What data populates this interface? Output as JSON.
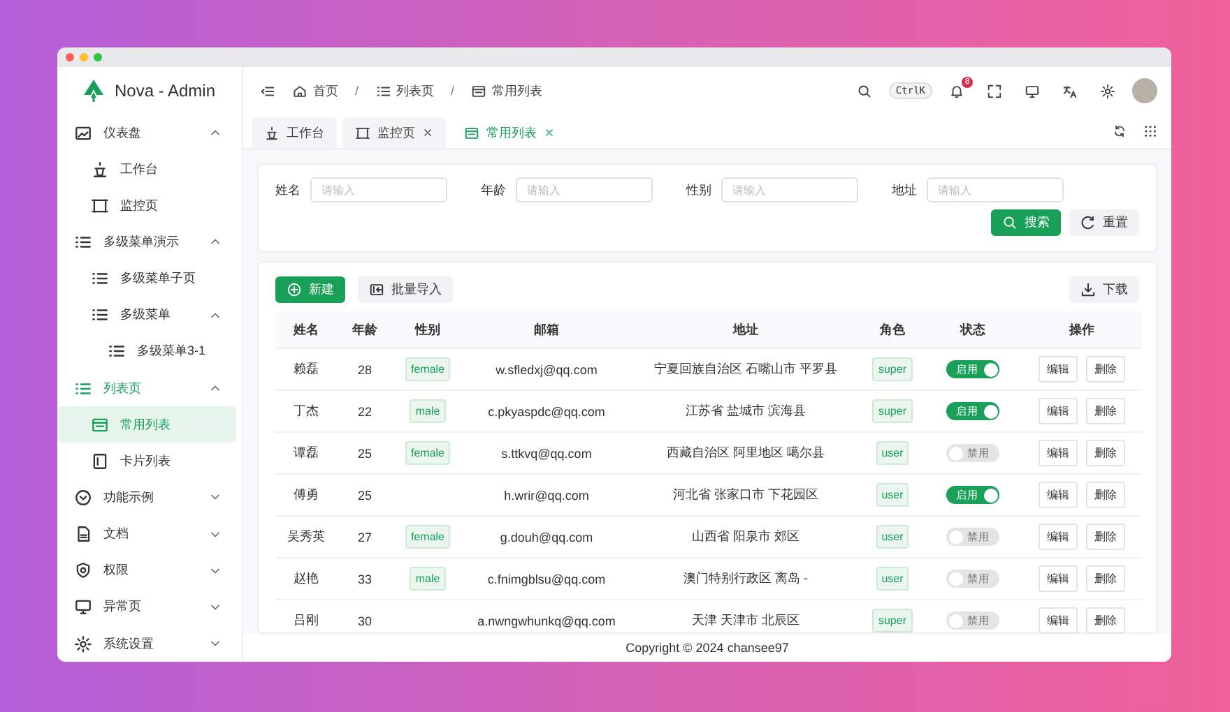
{
  "window": {
    "title": "Nova - Admin"
  },
  "sidebar": {
    "items": [
      {
        "label": "仪表盘",
        "expanded": true,
        "selected": false,
        "children": [
          {
            "label": "工作台",
            "selected": false
          },
          {
            "label": "监控页",
            "selected": false
          }
        ]
      },
      {
        "label": "多级菜单演示",
        "expanded": true,
        "selected": false,
        "children": [
          {
            "label": "多级菜单子页",
            "selected": false
          },
          {
            "label": "多级菜单",
            "expanded": true,
            "selected": false,
            "children": [
              {
                "label": "多级菜单3-1",
                "selected": false
              }
            ]
          }
        ]
      },
      {
        "label": "列表页",
        "expanded": true,
        "selected": false,
        "children": [
          {
            "label": "常用列表",
            "selected": true
          },
          {
            "label": "卡片列表",
            "selected": false
          }
        ]
      },
      {
        "label": "功能示例",
        "expanded": false,
        "selected": false
      },
      {
        "label": "文档",
        "expanded": false,
        "selected": false
      },
      {
        "label": "权限",
        "expanded": false,
        "selected": false
      },
      {
        "label": "异常页",
        "expanded": false,
        "selected": false
      },
      {
        "label": "系统设置",
        "expanded": false,
        "selected": false
      }
    ]
  },
  "breadcrumbs": [
    {
      "label": "首页"
    },
    {
      "separator": "/",
      "label": "列表页"
    },
    {
      "separator": "/",
      "label": "常用列表"
    }
  ],
  "header": {
    "shortcut": "CtrlK",
    "notification_count": "8"
  },
  "tabs": [
    {
      "label": "工作台",
      "selected": false,
      "closable": false
    },
    {
      "label": "监控页",
      "selected": false,
      "closable": true
    },
    {
      "label": "常用列表",
      "selected": true,
      "closable": true
    }
  ],
  "filters": [
    {
      "label": "姓名",
      "placeholder": "请输入"
    },
    {
      "label": "年龄",
      "placeholder": "请输入"
    },
    {
      "label": "性别",
      "placeholder": "请输入"
    },
    {
      "label": "地址",
      "placeholder": "请输入"
    }
  ],
  "filter_buttons": [
    {
      "label": "搜索",
      "kind": "primary"
    },
    {
      "label": "重置",
      "kind": "default"
    }
  ],
  "toolbar": {
    "left": [
      {
        "label": "新建",
        "kind": "primary"
      },
      {
        "label": "批量导入",
        "kind": "default"
      }
    ],
    "right": [
      {
        "label": "下载",
        "kind": "default"
      }
    ]
  },
  "table": {
    "columns": [
      "姓名",
      "年龄",
      "性别",
      "邮箱",
      "地址",
      "角色",
      "状态",
      "操作"
    ],
    "rows": [
      {
        "name": "赖磊",
        "age": "28",
        "gender": "female",
        "email": "w.sfledxj@qq.com",
        "address": "宁夏回族自治区 石嘴山市 平罗县",
        "role": "super",
        "status": {
          "on": true,
          "label": "启用"
        },
        "actions": [
          "编辑",
          "删除"
        ]
      },
      {
        "name": "丁杰",
        "age": "22",
        "gender": "male",
        "email": "c.pkyaspdc@qq.com",
        "address": "江苏省 盐城市 滨海县",
        "role": "super",
        "status": {
          "on": true,
          "label": "启用"
        },
        "actions": [
          "编辑",
          "删除"
        ]
      },
      {
        "name": "谭磊",
        "age": "25",
        "gender": "female",
        "email": "s.ttkvq@qq.com",
        "address": "西藏自治区 阿里地区 噶尔县",
        "role": "user",
        "status": {
          "on": false,
          "label": "禁用"
        },
        "actions": [
          "编辑",
          "删除"
        ]
      },
      {
        "name": "傅勇",
        "age": "25",
        "email": "h.wrir@qq.com",
        "address": "河北省 张家口市 下花园区",
        "role": "user",
        "status": {
          "on": true,
          "label": "启用"
        },
        "actions": [
          "编辑",
          "删除"
        ]
      },
      {
        "name": "吴秀英",
        "age": "27",
        "gender": "female",
        "email": "g.douh@qq.com",
        "address": "山西省 阳泉市 郊区",
        "role": "user",
        "status": {
          "on": false,
          "label": "禁用"
        },
        "actions": [
          "编辑",
          "删除"
        ]
      },
      {
        "name": "赵艳",
        "age": "33",
        "gender": "male",
        "email": "c.fnimgblsu@qq.com",
        "address": "澳门特别行政区 离岛 -",
        "role": "user",
        "status": {
          "on": false,
          "label": "禁用"
        },
        "actions": [
          "编辑",
          "删除"
        ]
      },
      {
        "name": "吕刚",
        "age": "30",
        "email": "a.nwngwhunkq@qq.com",
        "address": "天津 天津市 北辰区",
        "role": "super",
        "status": {
          "on": false,
          "label": "禁用"
        },
        "actions": [
          "编辑",
          "删除"
        ]
      }
    ]
  },
  "footer": "Copyright © 2024 chansee97"
}
